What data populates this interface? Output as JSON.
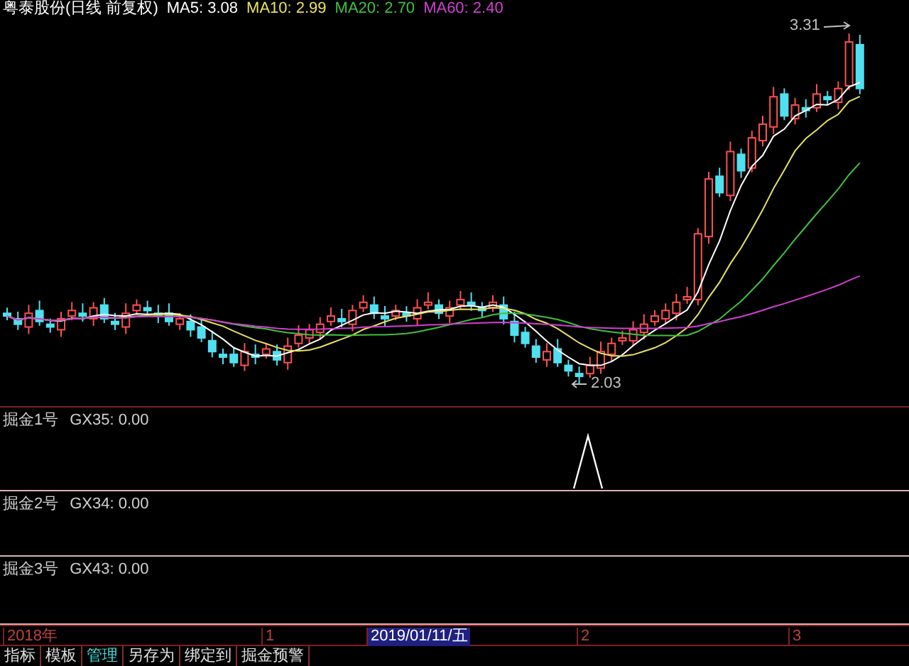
{
  "title": {
    "stock": "粤泰股份(日线 前复权)",
    "indicators": [
      {
        "label": "MA5: 3.08",
        "color": "#ffffff"
      },
      {
        "label": "MA10: 2.99",
        "color": "#e8e060"
      },
      {
        "label": "MA20: 2.70",
        "color": "#40c040"
      },
      {
        "label": "MA60: 2.40",
        "color": "#d040d0"
      }
    ]
  },
  "chart": {
    "annotations": [
      {
        "text": "3.31",
        "kind": "high"
      },
      {
        "text": "2.03",
        "kind": "low"
      }
    ]
  },
  "panels": [
    {
      "name": "掘金1号",
      "value": "GX35: 0.00",
      "kind": "spike"
    },
    {
      "name": "掘金2号",
      "value": "GX34: 0.00",
      "kind": "flat"
    },
    {
      "name": "掘金3号",
      "value": "GX43: 0.00",
      "kind": "flat"
    }
  ],
  "time_axis": [
    {
      "text": "2018年",
      "selected": false
    },
    {
      "text": "1",
      "selected": false
    },
    {
      "text": "2019/01/11/五",
      "selected": true
    },
    {
      "text": "2",
      "selected": false
    },
    {
      "text": "3",
      "selected": false
    }
  ],
  "tabs": [
    {
      "label": "指标",
      "selected": false
    },
    {
      "label": "模板",
      "selected": false
    },
    {
      "label": "管理",
      "selected": true
    },
    {
      "label": "另存为",
      "selected": false
    },
    {
      "label": "绑定到",
      "selected": false
    },
    {
      "label": "掘金预警",
      "selected": false
    }
  ]
}
